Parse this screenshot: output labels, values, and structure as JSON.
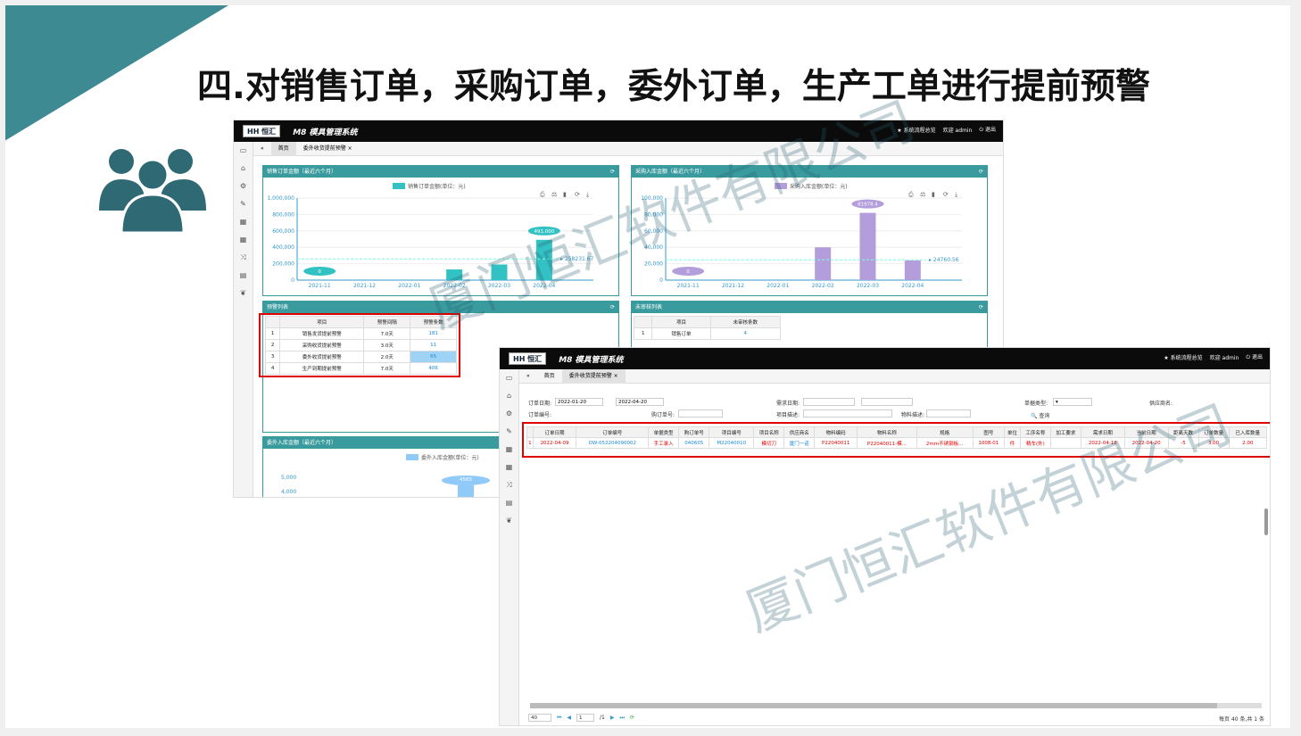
{
  "slide": {
    "title": "四.对销售订单，采购订单，委外订单，生产工单进行提前预警",
    "watermark": "厦门恒汇软件有限公司"
  },
  "app": {
    "logo": "HH 恒汇",
    "name": "M8 模具管理系统",
    "overview": "★ 系统流程总览",
    "welcome": "欢迎",
    "user": "admin",
    "logout": "⏻ 退出"
  },
  "tabs": {
    "home": "首页",
    "current": "委外收货提前预警 ×"
  },
  "sales_panel": {
    "title": "销售订单金额（最近六个月）",
    "legend": "销售订单金额(单位：元)",
    "chart_data": {
      "type": "bar",
      "title": "销售订单金额（最近六个月）",
      "categories": [
        "2021-11",
        "2021-12",
        "2022-01",
        "2022-02",
        "2022-03",
        "2022-04"
      ],
      "values": [
        0,
        0,
        0,
        130000,
        190000,
        491000
      ],
      "ylim": [
        0,
        1000000
      ],
      "yticks": [
        "1,000,000",
        "800,000",
        "600,000",
        "400,000",
        "200,000",
        "0"
      ],
      "avg": "258231.67",
      "labels": [
        "0",
        "",
        "",
        "",
        "",
        "491,000"
      ],
      "color": "#33c2c3"
    }
  },
  "purchase_panel": {
    "title": "采购入库金额（最近六个月）",
    "legend": "采购入库金额(单位：元)",
    "chart_data": {
      "type": "bar",
      "title": "采购入库金额（最近六个月）",
      "categories": [
        "2021-11",
        "2021-12",
        "2022-01",
        "2022-02",
        "2022-03",
        "2022-04"
      ],
      "values": [
        0,
        0,
        0,
        40000,
        81978.4,
        24000
      ],
      "ylim": [
        0,
        100000
      ],
      "yticks": [
        "100,000",
        "80,000",
        "60,000",
        "40,000",
        "20,000",
        "0"
      ],
      "avg": "24760.56",
      "labels": [
        "0",
        "",
        "",
        "",
        "81978.4",
        ""
      ],
      "color": "#b39ddb"
    }
  },
  "warn_panel": {
    "title": "预警列表",
    "headers": [
      "",
      "项目",
      "预警间隔",
      "预警条数"
    ],
    "rows": [
      [
        "1",
        "销售发货提前预警",
        "7.0天",
        "181"
      ],
      [
        "2",
        "采购收货提前预警",
        "3.0天",
        "11"
      ],
      [
        "3",
        "委外收货提前预警",
        "2.0天",
        "65"
      ],
      [
        "4",
        "生产到期提前预警",
        "7.0天",
        "406"
      ]
    ]
  },
  "review_panel": {
    "title": "未审核列表",
    "headers": [
      "",
      "项目",
      "未审核条数"
    ],
    "rows": [
      [
        "1",
        "销售订单",
        "4"
      ]
    ]
  },
  "outsource_panel": {
    "title": "委外入库金额（最近六个月）",
    "legend": "委外入库金额(单位：元)",
    "yticks": [
      "5,000",
      "4,000"
    ],
    "label": "4565"
  },
  "detail": {
    "filters": {
      "order_date": "订单日期:",
      "date_from": "2022-01-20",
      "date_to": "2022-04-20",
      "need_date": "需求日期:",
      "doc_type": "单据类型:",
      "supplier": "供应商名:",
      "order_no": "订单编号:",
      "po_no": "购订单号:",
      "item_desc": "项目描述:",
      "mat_desc": "物料描述:",
      "query": "🔍 查询"
    },
    "headers": [
      "",
      "订单日期",
      "订单编号",
      "单据类型",
      "购订单号",
      "项目编号",
      "项目名称",
      "供应商名",
      "物料编码",
      "物料名称",
      "规格",
      "图号",
      "单位",
      "工序名称",
      "加工要求",
      "需求日期",
      "当前日期",
      "距离天数",
      "订单数量",
      "已入库数量"
    ],
    "row": [
      "1",
      "2022-04-09",
      "OW-052204090002",
      "手工录入",
      "040605",
      "M22040010",
      "模切刀",
      "厦门一诺",
      "P22040011",
      "P22040011-模...",
      "2mm不锈钢板...",
      "1008-01",
      "件",
      "精车(外)",
      "",
      "2022-04-18",
      "2022-04-20",
      "-5",
      "3.00",
      "2.00"
    ],
    "pager": {
      "size": "40",
      "page": "1",
      "total": "/1",
      "info": "每页 40 条,共 1 条"
    }
  }
}
